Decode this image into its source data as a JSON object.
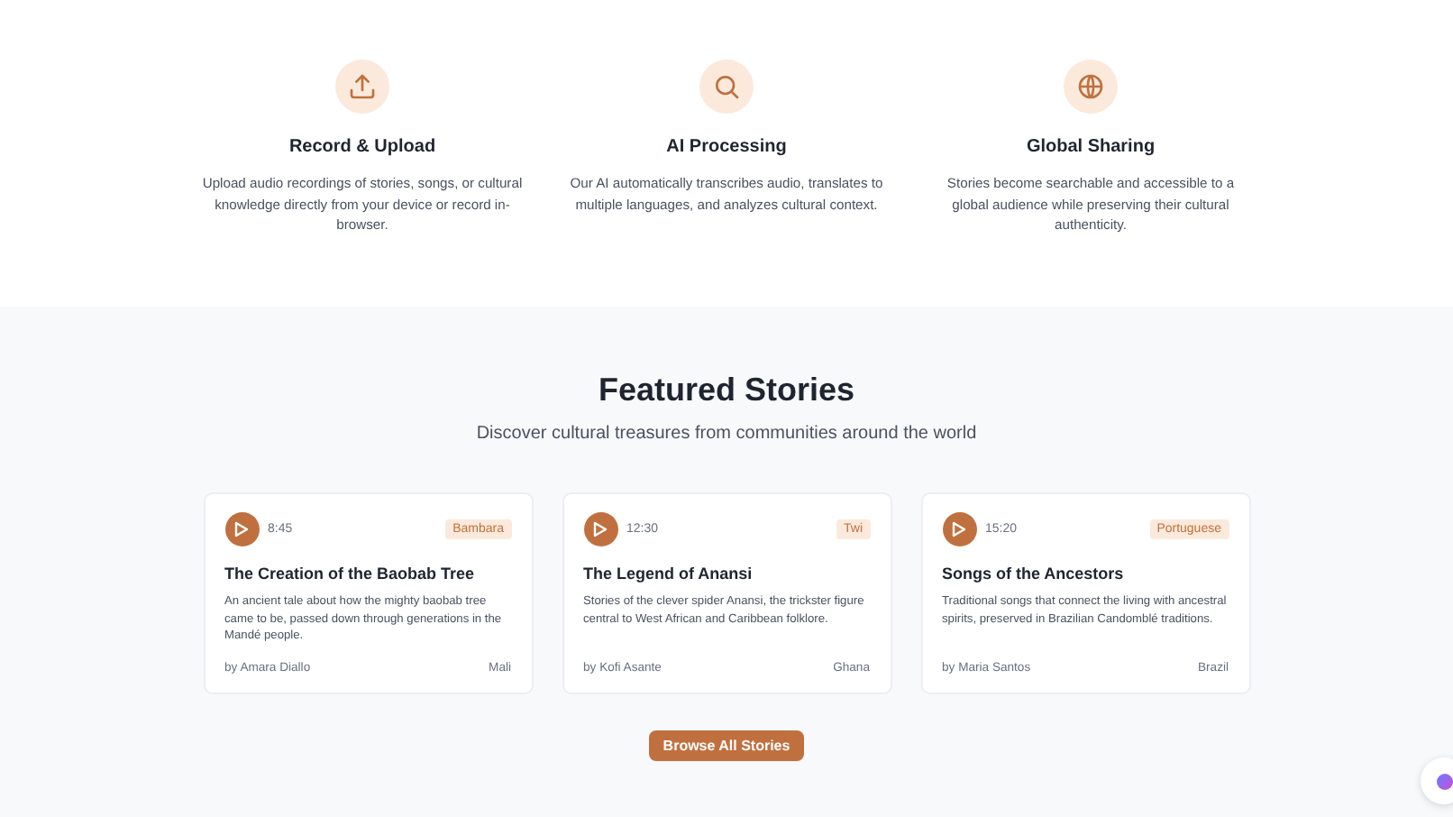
{
  "features": [
    {
      "title": "Record & Upload",
      "text": "Upload audio recordings of stories, songs, or cultural knowledge directly from your device or record in-browser."
    },
    {
      "title": "AI Processing",
      "text": "Our AI automatically transcribes audio, translates to multiple languages, and analyzes cultural context."
    },
    {
      "title": "Global Sharing",
      "text": "Stories become searchable and accessible to a global audience while preserving their cultural authenticity."
    }
  ],
  "featured": {
    "title": "Featured Stories",
    "subtitle": "Discover cultural treasures from communities around the world",
    "stories": [
      {
        "duration": "8:45",
        "language": "Bambara",
        "title": "The Creation of the Baobab Tree",
        "text": "An ancient tale about how the mighty baobab tree came to be, passed down through generations in the Mandé people.",
        "author": "by Amara Diallo",
        "country": "Mali"
      },
      {
        "duration": "12:30",
        "language": "Twi",
        "title": "The Legend of Anansi",
        "text": "Stories of the clever spider Anansi, the trickster figure central to West African and Caribbean folklore.",
        "author": "by Kofi Asante",
        "country": "Ghana"
      },
      {
        "duration": "15:20",
        "language": "Portuguese",
        "title": "Songs of the Ancestors",
        "text": "Traditional songs that connect the living with ancestral spirits, preserved in Brazilian Candomblé traditions.",
        "author": "by Maria Santos",
        "country": "Brazil"
      }
    ],
    "button": "Browse All Stories"
  }
}
